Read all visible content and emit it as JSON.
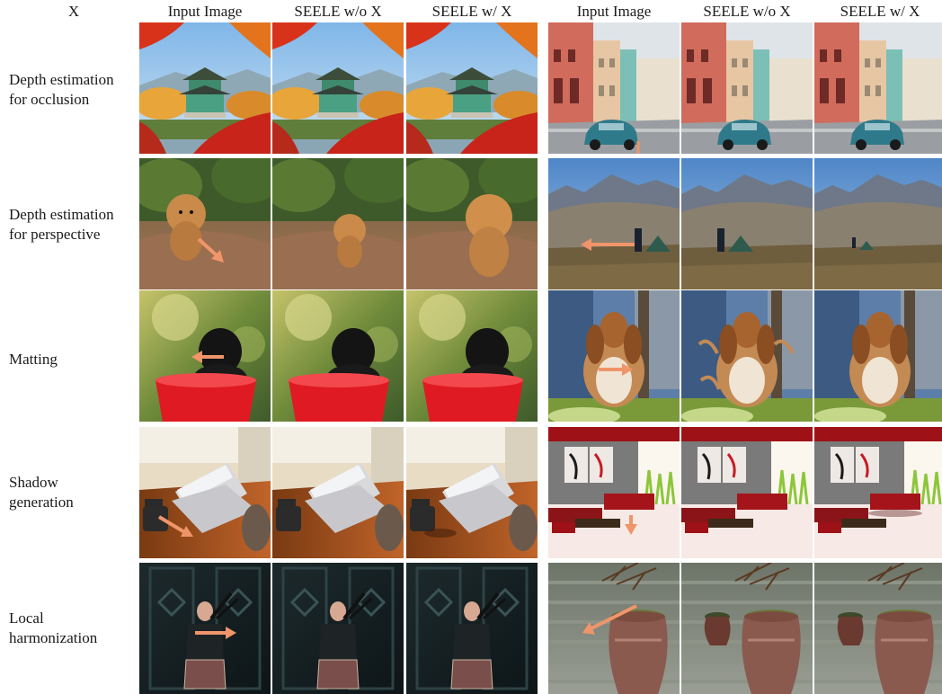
{
  "header": {
    "x_label": "X",
    "columns": [
      "Input Image",
      "SEELE w/o X",
      "SEELE w/ X",
      "Input Image",
      "SEELE w/o X",
      "SEELE w/ X"
    ]
  },
  "rows": [
    {
      "label_line1": "Depth estimation",
      "label_line2": "for occlusion"
    },
    {
      "label_line1": "Depth estimation",
      "label_line2": "for perspective"
    },
    {
      "label_line1": "Matting",
      "label_line2": ""
    },
    {
      "label_line1": "Shadow",
      "label_line2": "generation"
    },
    {
      "label_line1": "Local",
      "label_line2": "harmonization"
    }
  ],
  "colors": {
    "arrow": "#f0956a",
    "background": "#ffffff"
  }
}
